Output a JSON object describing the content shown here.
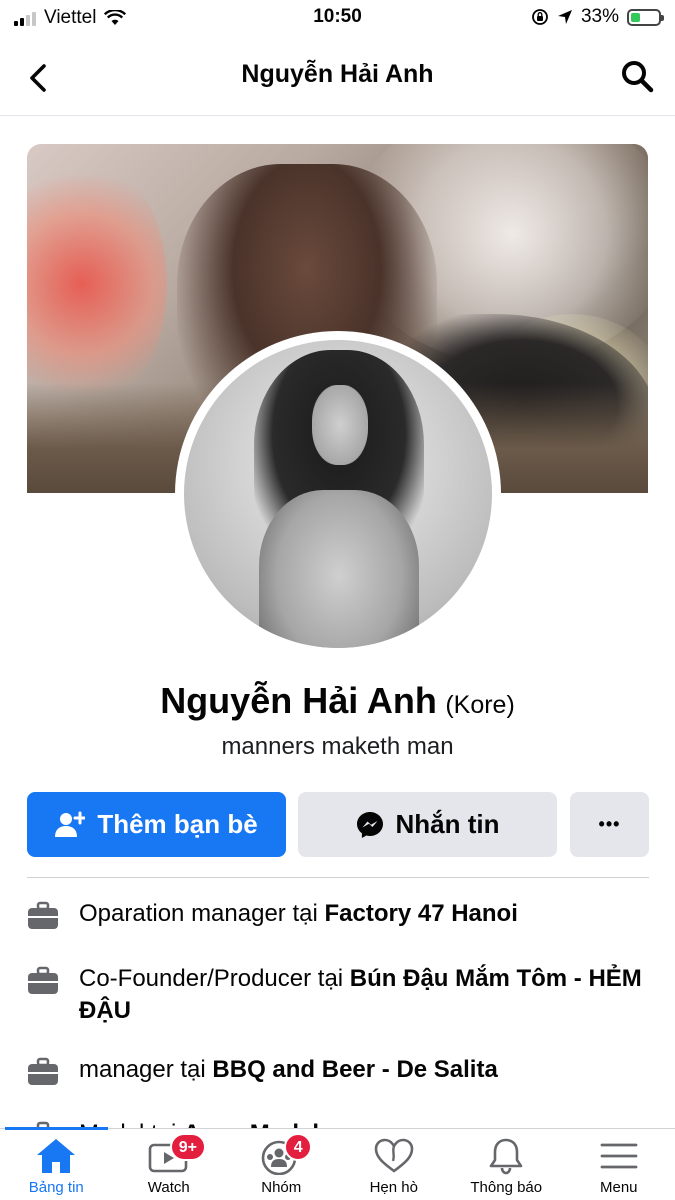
{
  "status_bar": {
    "carrier": "Viettel",
    "time": "10:50",
    "battery_percent": "33%",
    "battery_level": 0.33
  },
  "nav": {
    "title": "Nguyễn Hải Anh",
    "back_icon": "chevron-left-icon",
    "search_icon": "search-icon"
  },
  "profile": {
    "name": "Nguyễn Hải Anh",
    "alternate_name": "(Kore)",
    "bio": "manners maketh man"
  },
  "actions": {
    "add_friend_label": "Thêm bạn bè",
    "message_label": "Nhắn tin",
    "more_label": "•••"
  },
  "info": [
    {
      "prefix": "Oparation manager tại ",
      "place": "Factory 47 Hanoi",
      "icon": "briefcase-icon"
    },
    {
      "prefix": "Co-Founder/Producer tại ",
      "place": "Bún Đậu Mắm Tôm - HẺM ĐẬU",
      "icon": "briefcase-icon"
    },
    {
      "prefix": "manager tại ",
      "place": "BBQ and Beer - De Salita",
      "icon": "briefcase-icon"
    },
    {
      "prefix": "Model tại ",
      "place": "Aeon Models",
      "icon": "briefcase-icon"
    }
  ],
  "tabs": [
    {
      "label": "Bảng tin",
      "icon": "home-icon",
      "badge": "",
      "active": true
    },
    {
      "label": "Watch",
      "icon": "watch-video-icon",
      "badge": "9+",
      "active": false
    },
    {
      "label": "Nhóm",
      "icon": "groups-icon",
      "badge": "4",
      "active": false
    },
    {
      "label": "Hẹn hò",
      "icon": "dating-heart-icon",
      "badge": "",
      "active": false
    },
    {
      "label": "Thông báo",
      "icon": "bell-icon",
      "badge": "",
      "active": false
    },
    {
      "label": "Menu",
      "icon": "hamburger-menu-icon",
      "badge": "",
      "active": false
    }
  ],
  "colors": {
    "primary": "#1877f2",
    "badge": "#e41e3f",
    "button_secondary": "#e4e6eb",
    "text": "#050505"
  }
}
